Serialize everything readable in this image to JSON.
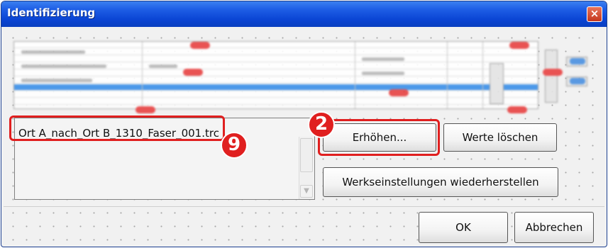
{
  "dialog": {
    "title": "Identifizierung",
    "close_symbol": "×"
  },
  "file_list": {
    "entries": [
      "Ort A_nach_Ort B_1310_Faser_001.trc"
    ]
  },
  "buttons": {
    "increase": "Erhöhen...",
    "clear_values": "Werte löschen",
    "restore_defaults": "Werkseinstellungen wiederherstellen",
    "ok": "OK",
    "cancel": "Abbrechen"
  },
  "annotations": {
    "badge_increase": "2",
    "badge_filename": "9"
  },
  "colors": {
    "titlebar": "#0b45d4",
    "annotation_red": "#e01f1f",
    "selection_blue": "#3a8fe8"
  }
}
